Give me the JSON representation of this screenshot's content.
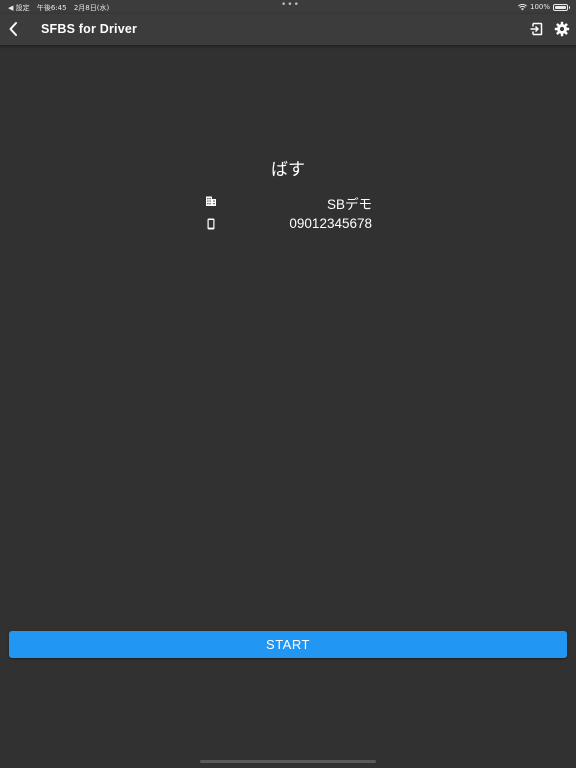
{
  "status_bar": {
    "back_app": "◀ 設定",
    "time": "午後6:45",
    "date": "2月8日(水)",
    "dots": "•••",
    "battery_text": "100%"
  },
  "app_bar": {
    "title": "SFBS for Driver",
    "back_icon": "chevron-left-icon",
    "logout_icon": "logout-icon",
    "settings_icon": "gear-icon"
  },
  "profile": {
    "name": "ばす",
    "company": "SBデモ",
    "company_icon": "building-icon",
    "phone": "09012345678",
    "phone_icon": "phone-icon"
  },
  "actions": {
    "start_label": "START"
  },
  "colors": {
    "background": "#313131",
    "app_bar": "#3c3c3c",
    "accent": "#2196f3"
  }
}
